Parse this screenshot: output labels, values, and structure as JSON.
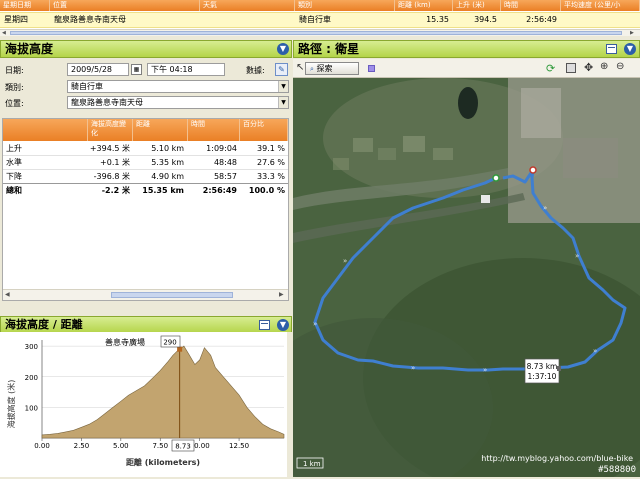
{
  "top_table": {
    "headers": [
      "星期日期",
      "位置",
      "天氣",
      "類別",
      "距離 (km)",
      "上升 (米)",
      "時間",
      "平均速度 (公里/小"
    ],
    "row": [
      "星期四",
      "龍泉路善息寺南天母",
      "",
      "騎自行車",
      "15.35",
      "394.5",
      "2:56:49",
      ""
    ]
  },
  "elevation_panel": {
    "title": "海拔高度",
    "date_label": "日期:",
    "date_value": "2009/5/28",
    "time_value": "下午 04:18",
    "weather_label": "數據:",
    "type_label": "類別:",
    "type_value": "騎自行車",
    "location_label": "位置:",
    "location_value": "龍泉路善息寺南天母"
  },
  "stats_table": {
    "headers": [
      "",
      "海拔高度變化",
      "距離",
      "時間",
      "百分比"
    ],
    "rows": [
      [
        "上升",
        "+394.5 米",
        "5.10 km",
        "1:09:04",
        "39.1 %"
      ],
      [
        "水準",
        "+0.1 米",
        "5.35 km",
        "48:48",
        "27.6 %"
      ],
      [
        "下降",
        "-396.8 米",
        "4.90 km",
        "58:57",
        "33.3 %"
      ],
      [
        "總和",
        "-2.2 米",
        "15.35 km",
        "2:56:49",
        "100.0 %"
      ]
    ]
  },
  "distance_panel": {
    "title": "海拔高度 / 距離"
  },
  "chart_data": {
    "type": "area",
    "xlabel": "距離 (kilometers)",
    "ylabel": "海拔高度 (米)",
    "xlim": [
      0,
      15.35
    ],
    "ylim": [
      0,
      320
    ],
    "x_ticks": [
      "0.00",
      "2.50",
      "5.00",
      "7.50",
      "10.00",
      "12.50"
    ],
    "y_ticks": [
      "300",
      "200",
      "100"
    ],
    "annotation_label": "善息寺廣場",
    "cursor_value": "290",
    "cursor_x_label": "8.73",
    "x": [
      0,
      0.5,
      1,
      1.5,
      2,
      2.5,
      3,
      3.5,
      4,
      4.5,
      5,
      5.5,
      6,
      6.5,
      7,
      7.5,
      8,
      8.3,
      8.6,
      8.73,
      9,
      9.3,
      9.7,
      10,
      10.3,
      10.7,
      11,
      11.5,
      12,
      12.5,
      13,
      13.5,
      14,
      14.5,
      15,
      15.35
    ],
    "y": [
      10,
      12,
      15,
      20,
      25,
      35,
      45,
      60,
      80,
      100,
      120,
      140,
      155,
      170,
      195,
      220,
      250,
      270,
      285,
      290,
      300,
      275,
      240,
      255,
      295,
      270,
      230,
      200,
      170,
      140,
      100,
      70,
      45,
      30,
      20,
      12
    ]
  },
  "map_panel": {
    "title": "路徑 : 衛星",
    "search_label": "探索",
    "tooltip_distance": "8.73 km",
    "tooltip_time": "1:37:10",
    "scale_label": "1 km",
    "watermark": "http://tw.myblog.yahoo.com/blue-bike",
    "image_id": "#588800"
  },
  "colors": {
    "header_green": "#b4d449",
    "header_orange": "#ea7f25",
    "route_blue": "#3f7fd0",
    "chart_fill": "#c2a46f"
  }
}
